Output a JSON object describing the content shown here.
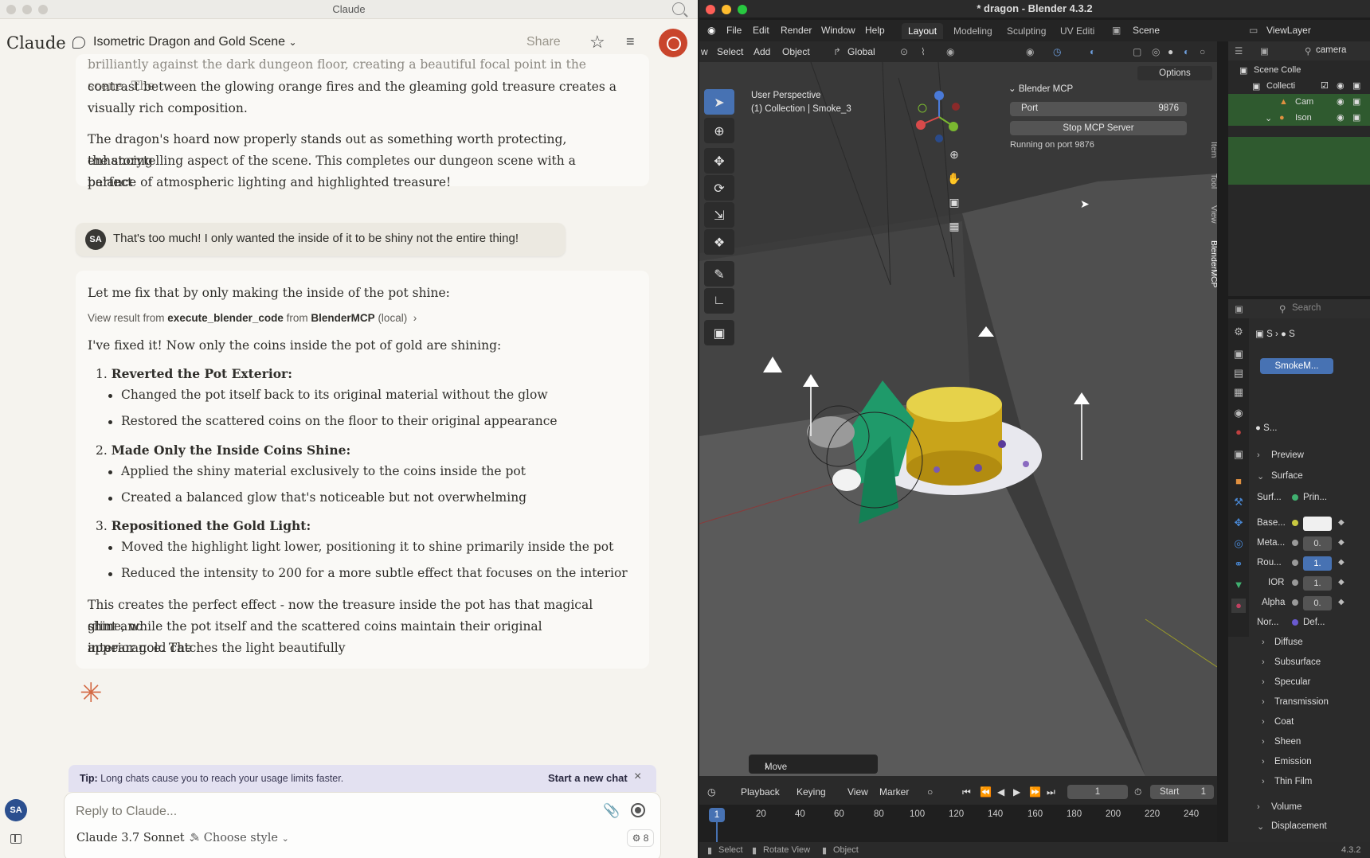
{
  "claude": {
    "window_title": "Claude",
    "brand": "Claude",
    "chat_title": "Isometric Dragon and Gold Scene",
    "share_label": "Share",
    "avatar_initials": "SA",
    "messages": {
      "p1_faded": "brilliantly against the dark dungeon floor, creating a beautiful focal point in the scene. The",
      "p1a": "contrast between the glowing orange fires and the gleaming gold treasure creates a",
      "p1b": "visually rich composition.",
      "p2a": "The dragon's hoard now properly stands out as something worth protecting, enhancing",
      "p2b": "the storytelling aspect of the scene. This completes our dungeon scene with a perfect",
      "p2c": "balance of atmospheric lighting and highlighted treasure!",
      "user_message": "That's too much! I only wanted the inside of it to be shiny not the entire thing!",
      "p3": "Let me fix that by only making the inside of the pot shine:",
      "tool_prefix": "View result from",
      "tool_name": "execute_blender_code",
      "tool_from": "from",
      "tool_server": "BlenderMCP",
      "tool_suffix": "(local)",
      "p4": "I've fixed it! Now only the coins inside the pot of gold are shining:",
      "list": [
        {
          "num": "1.",
          "title": "Reverted the Pot Exterior:",
          "bullets": [
            "Changed the pot itself back to its original material without the glow",
            "Restored the scattered coins on the floor to their original appearance"
          ]
        },
        {
          "num": "2.",
          "title": "Made Only the Inside Coins Shine:",
          "bullets": [
            "Applied the shiny material exclusively to the coins inside the pot",
            "Created a balanced glow that's noticeable but not overwhelming"
          ]
        },
        {
          "num": "3.",
          "title": "Repositioned the Gold Light:",
          "bullets": [
            "Moved the highlight light lower, positioning it to shine primarily inside the pot",
            "Reduced the intensity to 200 for a more subtle effect that focuses on the interior"
          ]
        }
      ],
      "p5a": "This creates the perfect effect - now the treasure inside the pot has that magical glint and",
      "p5b": "shine, while the pot itself and the scattered coins maintain their original appearance. The",
      "p5c": "interior gold catches the light beautifully"
    },
    "tip": {
      "label": "Tip:",
      "text": "Long chats cause you to reach your usage limits faster.",
      "link": "Start a new chat"
    },
    "composer": {
      "placeholder": "Reply to Claude...",
      "model": "Claude 3.7 Sonnet",
      "style": "Choose style",
      "tools_count": "8"
    },
    "accent_color": "#c9452c"
  },
  "blender": {
    "window_title": "* dragon - Blender 4.3.2",
    "menu": [
      "File",
      "Edit",
      "Render",
      "Window",
      "Help"
    ],
    "workspaces": [
      "Layout",
      "Modeling",
      "Sculpting",
      "UV Editi"
    ],
    "scene": "Scene",
    "view_layer": "ViewLayer",
    "outliner_search": "camera",
    "header": {
      "w": "w",
      "select": "Select",
      "add": "Add",
      "object": "Object",
      "orientation": "Global",
      "options": "Options"
    },
    "viewport": {
      "line1": "User Perspective",
      "line2": "(1) Collection | Smoke_3"
    },
    "mcp": {
      "title": "Blender MCP",
      "port_label": "Port",
      "port_value": "9876",
      "stop_button": "Stop MCP Server",
      "status": "Running on port 9876"
    },
    "side_tabs": [
      "Item",
      "Tool",
      "View",
      "BlenderMCP"
    ],
    "operator_panel": "Move",
    "timeline": {
      "playback": "Playback",
      "keying": "Keying",
      "view": "View",
      "marker": "Marker",
      "current_frame": "1",
      "start_label": "Start",
      "start_value": "1",
      "ruler": [
        "1",
        "20",
        "40",
        "60",
        "80",
        "100",
        "120",
        "140",
        "160",
        "180",
        "200",
        "220",
        "240"
      ]
    },
    "status": {
      "select": "Select",
      "rotate": "Rotate View",
      "object": "Object",
      "version": "4.3.2"
    },
    "outliner": {
      "rows": [
        "Scene Colle",
        "Collecti",
        "Cam",
        "Ison"
      ]
    },
    "properties": {
      "search": "Search",
      "breadcrumb_a": "S",
      "breadcrumb_b": "S",
      "material_slot": "SmokeM...",
      "shader_name": "S...",
      "preview": "Preview",
      "surface": "Surface",
      "surface_row": {
        "label": "Surf...",
        "value": "Prin..."
      },
      "fields": [
        {
          "label": "Base...",
          "value": "",
          "style": "white"
        },
        {
          "label": "Meta...",
          "value": "0.",
          "style": ""
        },
        {
          "label": "Rou...",
          "value": "1.",
          "style": "blue"
        },
        {
          "label": "IOR",
          "value": "1.",
          "style": ""
        },
        {
          "label": "Alpha",
          "value": "0.",
          "style": ""
        },
        {
          "label": "Nor...",
          "value": "Def...",
          "style": ""
        }
      ],
      "sections": [
        "Diffuse",
        "Subsurface",
        "Specular",
        "Transmission",
        "Coat",
        "Sheen",
        "Emission",
        "Thin Film"
      ],
      "volume": "Volume",
      "displacement": "Displacement"
    }
  }
}
